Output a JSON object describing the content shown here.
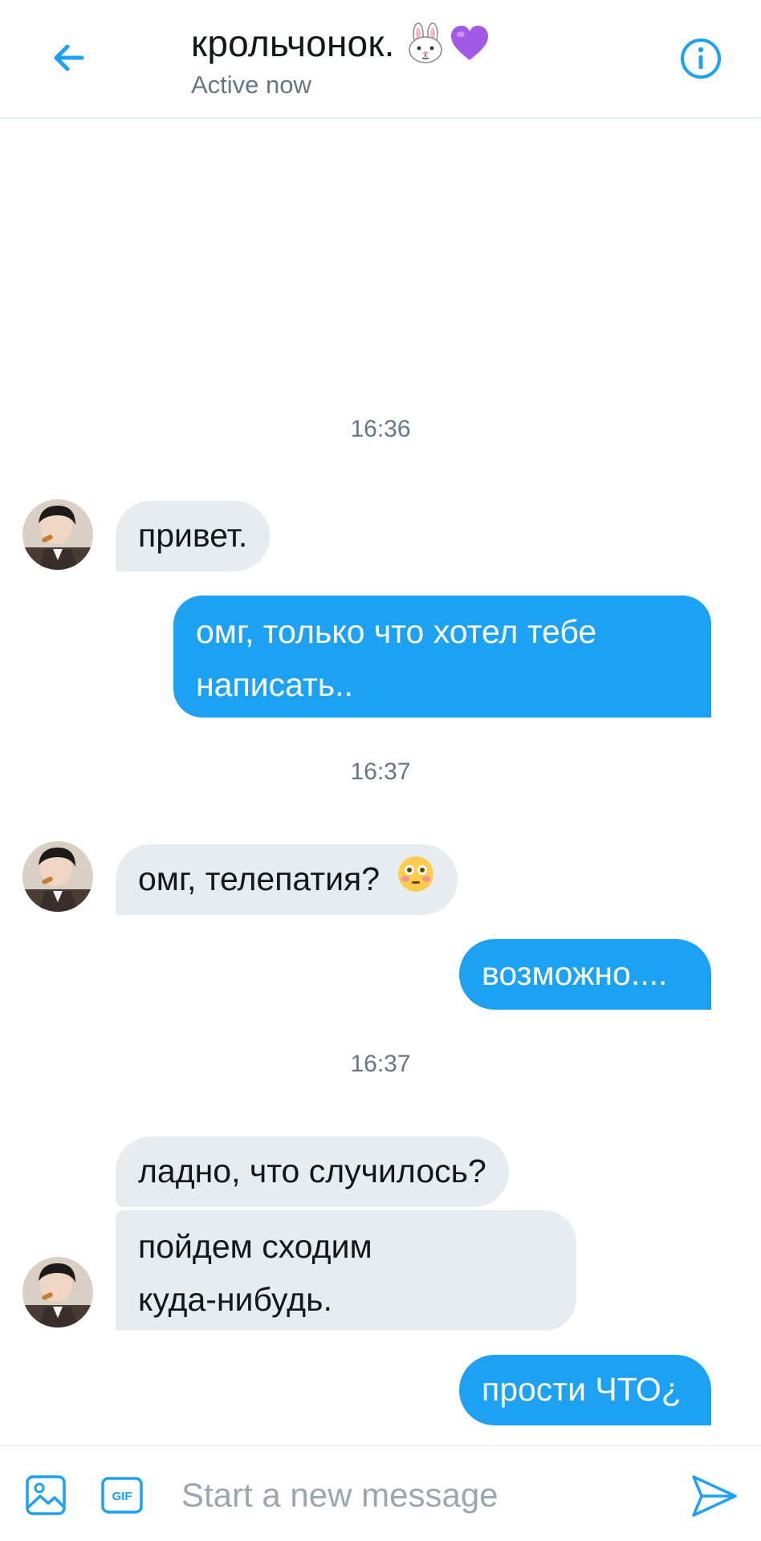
{
  "header": {
    "title": "крольчонок.",
    "title_emojis": [
      "rabbit-face-icon",
      "purple-heart-icon"
    ],
    "status": "Active now",
    "back_icon": "arrow-left-icon",
    "info_icon": "info-icon"
  },
  "colors": {
    "accent": "#1da1f2",
    "incoming_bubble": "#e6ecf0",
    "muted_text": "#657786"
  },
  "messages": {
    "ts1": "16:36",
    "m1": "привет.",
    "m2_line1": "омг, только что хотел тебе",
    "m2_line2": "написать..",
    "ts2": "16:37",
    "m3": "омг, телепатия?",
    "m3_emoji": "flushed-face-icon",
    "m4": "возможно....",
    "ts3": "16:37",
    "m5": "ладно, что случилось?",
    "m6_line1": "пойдем сходим",
    "m6_line2": "куда-нибудь.",
    "m7": "прости ЧТО¿"
  },
  "composer": {
    "placeholder": "Start a new message",
    "media_icon": "image-icon",
    "gif_label": "GIF",
    "send_icon": "send-icon"
  }
}
